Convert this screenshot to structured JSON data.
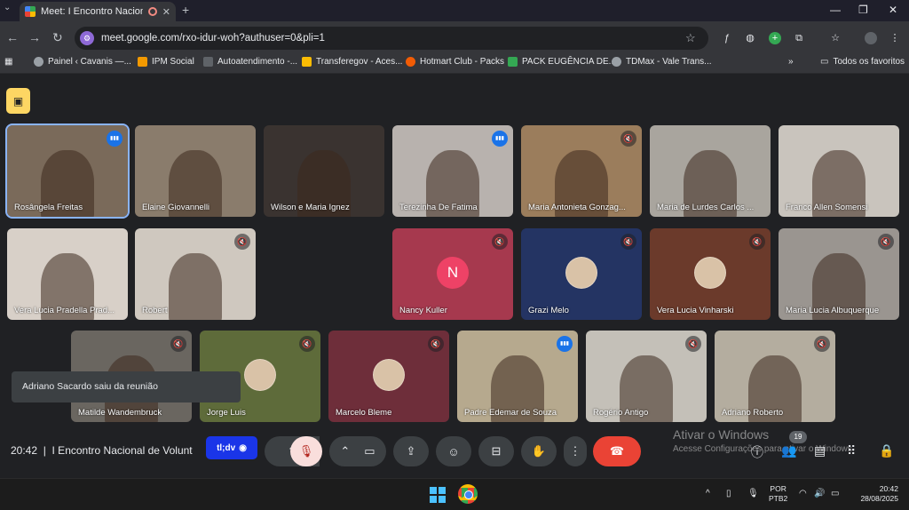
{
  "browser": {
    "tab_title": "Meet: I Encontro Nacional d",
    "url": "meet.google.com/rxo-idur-woh?authuser=0&pli=1",
    "new_tab": "+",
    "tab_menu": "⌄"
  },
  "bookmarks": [
    {
      "label": "Painel ‹ Cavanis —...",
      "color": "#9aa0a6"
    },
    {
      "label": "IPM Social",
      "color": "#f29900"
    },
    {
      "label": "Autoatendimento -...",
      "color": "#9aa0a6"
    },
    {
      "label": "Transferegov - Aces...",
      "color": "#fbbc04"
    },
    {
      "label": "Hotmart Club - Packs",
      "color": "#f25c05"
    },
    {
      "label": "PACK EUGÊNCIA DE...",
      "color": "#34a853"
    },
    {
      "label": "TDMax - Vale Trans...",
      "color": "#9aa0a6"
    }
  ],
  "bookmarks_more": "»",
  "bookmarks_folder": "Todos os favoritos",
  "participants": [
    {
      "name": "Rosângela Freitas",
      "state": "speaking",
      "bg": "#7a6a5a"
    },
    {
      "name": "Elaine Giovannelli",
      "state": "none",
      "bg": "#8a7c6c"
    },
    {
      "name": "Wilson e Maria Ignez",
      "state": "none",
      "bg": "#3a3330"
    },
    {
      "name": "Terezinha De Fatima",
      "state": "speaking",
      "bg": "#b8b2ae"
    },
    {
      "name": "Maria Antonieta Gonzag...",
      "state": "muted",
      "bg": "#9b7d5c"
    },
    {
      "name": "Maria de Lurdes Carlos ...",
      "state": "none",
      "bg": "#a9a59e"
    },
    {
      "name": "Franco Allen Somensi",
      "state": "none",
      "bg": "#c9c4bd"
    },
    {
      "name": "Vera Lucia Pradella Prad...",
      "state": "none",
      "bg": "#d8d0c8"
    },
    {
      "name": "Robert",
      "state": "muted",
      "bg": "#cfc8bf"
    },
    {
      "name": "Nancy Kuller",
      "state": "muted",
      "bg": "#a6394e",
      "letter": "N"
    },
    {
      "name": "Grazi Melo",
      "state": "muted",
      "bg": "#243463"
    },
    {
      "name": "Vera Lucia Vinharski",
      "state": "muted",
      "bg": "#6b3a2b"
    },
    {
      "name": "Maria Lucia Albuquerque",
      "state": "muted",
      "bg": "#9a9590"
    },
    {
      "name": "Matilde Wandembruck",
      "state": "muted",
      "bg": "#6a6660"
    },
    {
      "name": "Jorge Luis",
      "state": "muted",
      "bg": "#5e6b3a"
    },
    {
      "name": "Marcelo Bleme",
      "state": "muted",
      "bg": "#6e2e3a"
    },
    {
      "name": "Padre Edemar de Souza",
      "state": "speaking",
      "bg": "#b6a98e"
    },
    {
      "name": "Rogério Antigo",
      "state": "muted",
      "bg": "#c4c0b8"
    },
    {
      "name": "Adriano Roberto",
      "state": "muted",
      "bg": "#b4ad9f"
    }
  ],
  "toast": "Adriano Sacardo saiu da reunião",
  "meeting": {
    "time": "20:42",
    "title": "I Encontro Nacional de Volunt"
  },
  "tldv_label": "tl;dv",
  "participant_count": "19",
  "windows_activation": {
    "title": "Ativar o Windows",
    "subtitle": "Acesse Configurações para ativar o Windows."
  },
  "taskbar": {
    "lang_line1": "POR",
    "lang_line2": "PTB2",
    "time": "20:42",
    "date": "28/08/2025"
  },
  "colors": {
    "accent": "#8ab4f8",
    "end_call": "#ea4335",
    "mic_off_bg": "#f9dedc",
    "alert": "#fdd663"
  }
}
